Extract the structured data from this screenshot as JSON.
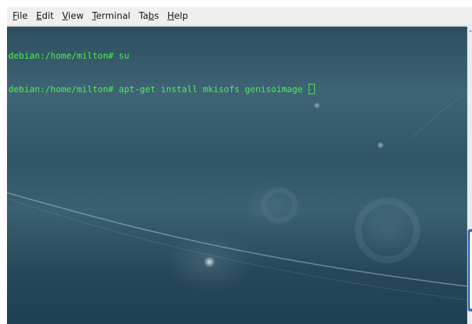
{
  "menu": {
    "items": [
      {
        "label": "File",
        "mnemonic": "F",
        "rest": "ile"
      },
      {
        "label": "Edit",
        "mnemonic": "E",
        "rest": "dit"
      },
      {
        "label": "View",
        "mnemonic": "V",
        "rest": "iew"
      },
      {
        "label": "Terminal",
        "mnemonic": "T",
        "rest": "erminal"
      },
      {
        "label": "Tabs",
        "pre": "Ta",
        "mnemonic": "b",
        "rest": "s"
      },
      {
        "label": "Help",
        "mnemonic": "H",
        "rest": "elp"
      }
    ]
  },
  "terminal": {
    "lines": [
      {
        "prompt": "debian:/home/milton# ",
        "command": "su"
      },
      {
        "prompt": "debian:/home/milton# ",
        "command": "apt-get install mkisofs genisoimage "
      }
    ],
    "text_color": "#4cf04a"
  },
  "colors": {
    "accent": "#3b6fb3",
    "menubar_bg": "#efefef"
  },
  "icons": {
    "scroll_up": "chevron-up-icon"
  }
}
